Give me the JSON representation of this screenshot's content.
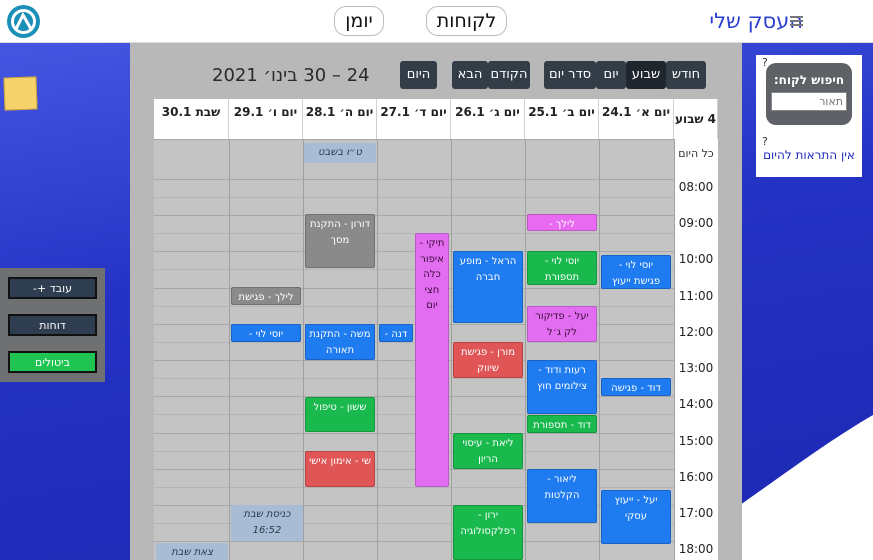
{
  "header": {
    "brand": "העסק שלי",
    "tabs": [
      {
        "label": "לקוחות"
      },
      {
        "label": "יומן"
      }
    ]
  },
  "calendar": {
    "range_title": "24 – 30 בינו׳ 2021",
    "toolbar": {
      "month": "חודש",
      "week": "שבוע",
      "day": "יום",
      "agenda": "סדר יום",
      "prev": "הקודם",
      "next": "הבא",
      "today": "היום"
    },
    "week_label": "4 שבוע",
    "allday_label": "כל היום",
    "days": [
      {
        "label": "יום א׳ 24.1"
      },
      {
        "label": "יום ב׳ 25.1"
      },
      {
        "label": "יום ג׳ 26.1"
      },
      {
        "label": "יום ד׳ 27.1"
      },
      {
        "label": "יום ה׳ 28.1"
      },
      {
        "label": "יום ו׳ 29.1"
      },
      {
        "label": "שבת 30.1"
      }
    ],
    "hours": [
      "08:00",
      "09:00",
      "10:00",
      "11:00",
      "12:00",
      "13:00",
      "14:00",
      "15:00",
      "16:00",
      "17:00",
      "18:00"
    ],
    "events": [
      {
        "text": "ט״ו בשבט",
        "color": "shabbat"
      },
      {
        "text": "יוסי לוי - פגישת ייעוץ",
        "color": "blue"
      },
      {
        "text": "יעל - ייעוץ עסקי",
        "color": "blue"
      },
      {
        "text": "דוד - פגישה",
        "color": "blue"
      },
      {
        "text": "לילך - צבע+גוונים",
        "color": "label-pink"
      },
      {
        "text": "יוסי לוי - תספורת",
        "color": "green"
      },
      {
        "text": "יעל - פדיקור לק ג׳ל",
        "color": "pink"
      },
      {
        "text": "רעות ודוד - צילומים חוץ",
        "color": "blue"
      },
      {
        "text": "דוד - תספורת",
        "color": "green"
      },
      {
        "text": "ליאור - הקלטות",
        "color": "blue"
      },
      {
        "text": "הראל - מופע חברה",
        "color": "blue"
      },
      {
        "text": "מורן - פגישת שיווק",
        "color": "red"
      },
      {
        "text": "ליאת - עיסוי הריון",
        "color": "green"
      },
      {
        "text": "ירון - רפלקסולוגיה",
        "color": "green"
      },
      {
        "text": "תיקי - איפור כלה חצי יום",
        "color": "pink"
      },
      {
        "text": "דנה -",
        "color": "blue"
      },
      {
        "text": "דורון - התקנת מסך",
        "color": "gray"
      },
      {
        "text": "משה - התקנת תאורה",
        "color": "blue"
      },
      {
        "text": "ששון - טיפול",
        "color": "green"
      },
      {
        "text": "שי - אימון אישי",
        "color": "red"
      },
      {
        "text": "לילך - פגישת ייעוץ",
        "color": "gray"
      },
      {
        "text": "יוסי לוי - פגישה",
        "color": "blue"
      },
      {
        "text": "כניסת שבת 16:52",
        "color": "shabbat"
      },
      {
        "text": "צאת שבת",
        "color": "shabbat"
      }
    ]
  },
  "left_panel": {
    "employee": "עובד +-",
    "reports": "דוחות",
    "cancellations": "ביטולים"
  },
  "right_panel": {
    "search_title": "חיפוש לקוח:",
    "search_placeholder": "תאור",
    "help_mark": "?",
    "no_alerts": "אין התראות להיום"
  }
}
